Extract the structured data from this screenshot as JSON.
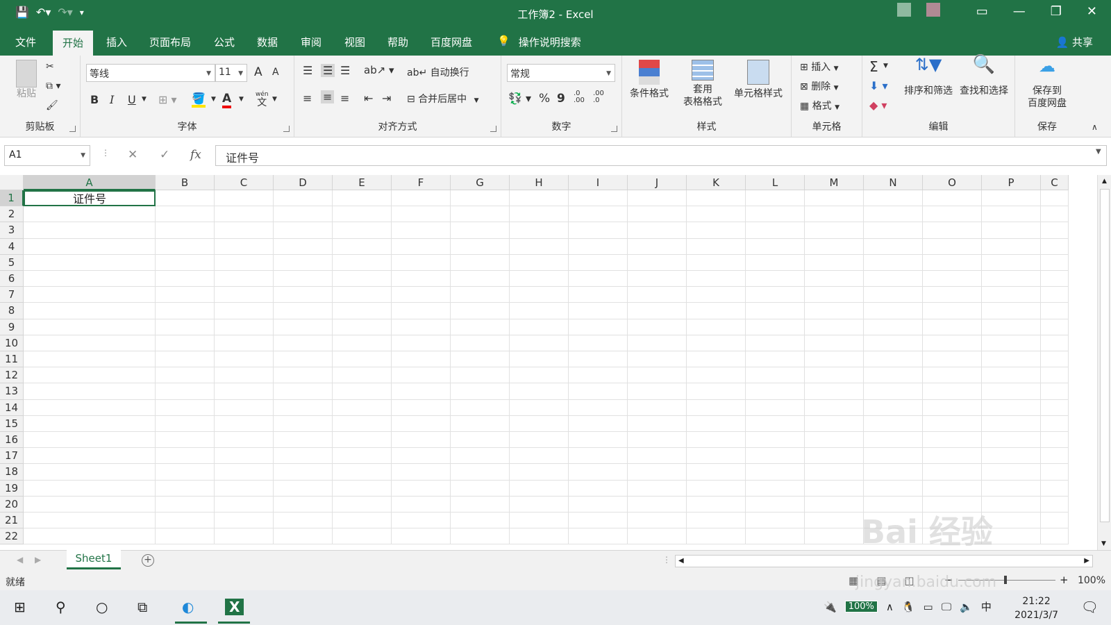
{
  "app": {
    "title": "工作簿2  -  Excel"
  },
  "menu": {
    "tabs": [
      "文件",
      "开始",
      "插入",
      "页面布局",
      "公式",
      "数据",
      "审阅",
      "视图",
      "帮助",
      "百度网盘"
    ],
    "active": "开始",
    "tell_me": "操作说明搜索",
    "share": "共享"
  },
  "ribbon": {
    "clipboard": {
      "label": "剪贴板",
      "paste": "粘贴"
    },
    "font": {
      "label": "字体",
      "font_name": "等线",
      "font_size": "11",
      "grow": "A",
      "shrink": "A",
      "bold": "B",
      "italic": "I",
      "underline": "U",
      "font_color": "A",
      "phonetic": "文",
      "phonetic_top": "wén"
    },
    "alignment": {
      "label": "对齐方式",
      "wrap": "自动换行",
      "merge": "合并后居中"
    },
    "number": {
      "label": "数字",
      "format": "常规",
      "percent": "%",
      "comma": "9",
      "inc_decimal": ".0\n.00",
      "dec_decimal": ".00\n.0"
    },
    "styles": {
      "label": "样式",
      "conditional": "条件格式",
      "table": "套用\n表格格式",
      "cell_styles": "单元格样式"
    },
    "cells": {
      "label": "单元格",
      "insert": "插入",
      "delete": "删除",
      "format": "格式"
    },
    "editing": {
      "label": "编辑",
      "sigma": "Σ",
      "sort": "排序和筛选",
      "find": "查找和选择"
    },
    "save": {
      "label": "保存",
      "save_baidu": "保存到\n百度网盘"
    }
  },
  "formula_bar": {
    "name_box": "A1",
    "fx": "fx",
    "value": "证件号"
  },
  "grid": {
    "columns": [
      "A",
      "B",
      "C",
      "D",
      "E",
      "F",
      "G",
      "H",
      "I",
      "J",
      "K",
      "L",
      "M",
      "N",
      "O",
      "P",
      "C"
    ],
    "rows": [
      "1",
      "2",
      "3",
      "4",
      "5",
      "6",
      "7",
      "8",
      "9",
      "10",
      "11",
      "12",
      "13",
      "14",
      "15",
      "16",
      "17",
      "18",
      "19",
      "20",
      "21",
      "22"
    ],
    "active_cell": "A1",
    "cells": {
      "A1": "证件号"
    }
  },
  "sheets": {
    "tabs": [
      "Sheet1"
    ],
    "add": "+"
  },
  "status": {
    "ready": "就绪",
    "zoom": "100%"
  },
  "taskbar": {
    "battery": "100%",
    "ime": "中",
    "time": "21:22",
    "date": "2021/3/7"
  },
  "watermark": {
    "main": "Bai 经验",
    "url": "jingyan.baidu.com"
  },
  "colors": {
    "accent": "#217346",
    "ribbon_bg": "#f3f3f3",
    "grid_line": "#e1e1e1"
  }
}
